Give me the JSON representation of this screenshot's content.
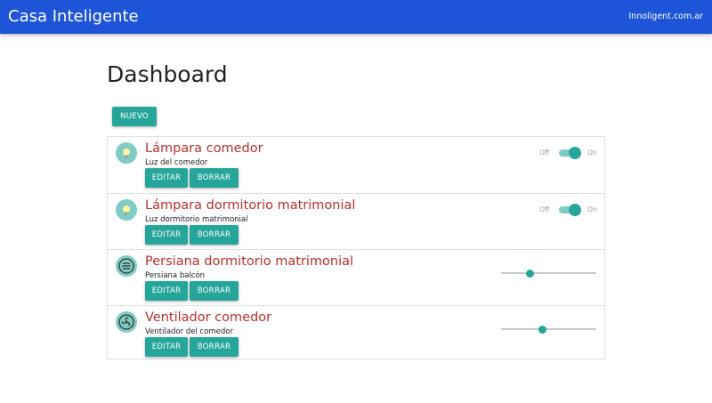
{
  "navbar": {
    "brand": "Casa Inteligente",
    "link": "Innoligent.com.ar",
    "color": "#1e55d8"
  },
  "page": {
    "title": "Dashboard",
    "new_button": "NUEVO"
  },
  "accent": "#26a69a",
  "devices": [
    {
      "name": "Lámpara comedor",
      "description": "Luz del comedor",
      "icon": "lightbulb-icon",
      "control": "switch",
      "state": "on",
      "off_label": "Off",
      "on_label": "On",
      "edit_label": "EDITAR",
      "delete_label": "BORRAR"
    },
    {
      "name": "Lámpara dormitorio matrimonial",
      "description": "Luz dormitorio matrimonial",
      "icon": "lightbulb-icon",
      "control": "switch",
      "state": "on",
      "off_label": "Off",
      "on_label": "On",
      "edit_label": "EDITAR",
      "delete_label": "BORRAR"
    },
    {
      "name": "Persiana dormitorio matrimonial",
      "description": "Persiana balcón",
      "icon": "blind-icon",
      "control": "slider",
      "level_percent": 30,
      "edit_label": "EDITAR",
      "delete_label": "BORRAR"
    },
    {
      "name": "Ventilador comedor",
      "description": "Ventilador del comedor",
      "icon": "fan-icon",
      "control": "slider",
      "level_percent": 43,
      "edit_label": "EDITAR",
      "delete_label": "BORRAR"
    }
  ]
}
